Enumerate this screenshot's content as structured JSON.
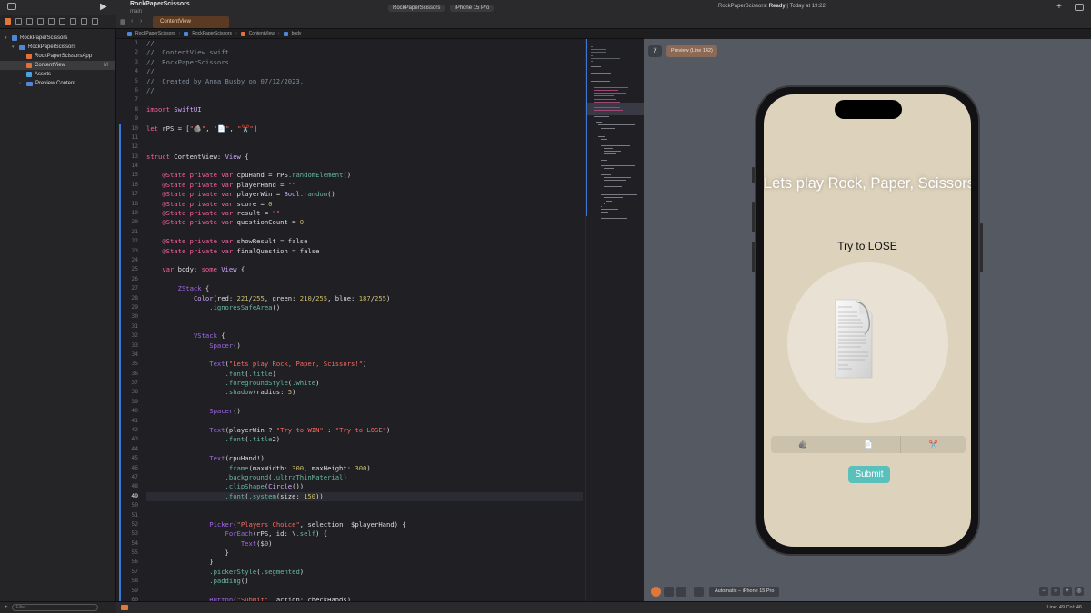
{
  "titlebar": {
    "project": "RockPaperScissors",
    "branch": "main",
    "scheme_target": "RockPaperScissors",
    "scheme_device": "iPhone 15 Pro",
    "status_prefix": "RockPaperScissors: ",
    "status_state": "Ready",
    "status_time": " | Today at 19:22"
  },
  "navigator": {
    "items": [
      {
        "label": "RockPaperScissors",
        "indent": 0,
        "icon": "project-icon",
        "chevron": "▾"
      },
      {
        "label": "RockPaperScissors",
        "indent": 1,
        "icon": "folder-icon",
        "chevron": "▾"
      },
      {
        "label": "RockPaperScissorsApp",
        "indent": 2,
        "icon": "swift-file-icon",
        "chevron": ""
      },
      {
        "label": "ContentView",
        "indent": 2,
        "icon": "swift-file-icon",
        "chevron": "",
        "badge": "M",
        "selected": true
      },
      {
        "label": "Assets",
        "indent": 2,
        "icon": "asset-catalog-icon",
        "chevron": ""
      },
      {
        "label": "Preview Content",
        "indent": 2,
        "icon": "folder-icon",
        "chevron": "›"
      }
    ],
    "filter_placeholder": "Filter"
  },
  "tab": {
    "label": "ContentView"
  },
  "jumpbar": [
    "RockPaperScissors",
    "RockPaperScissors",
    "ContentView",
    "body"
  ],
  "editor": {
    "current_line": 49,
    "lines": [
      "//",
      "//  ContentView.swift",
      "//  RockPaperScissors",
      "//",
      "//  Created by Anna Busby on 07/12/2023.",
      "//",
      "",
      "import SwiftUI",
      "",
      "let rPS = [\"🪨\", \"📄\", \"✂️\"]",
      "",
      "",
      "struct ContentView: View {",
      "",
      "    @State private var cpuHand = rPS.randomElement()",
      "    @State private var playerHand = \"\"",
      "    @State private var playerWin = Bool.random()",
      "    @State private var score = 0",
      "    @State private var result = \"\"",
      "    @State private var questionCount = 0",
      "",
      "    @State private var showResult = false",
      "    @State private var finalQuestion = false",
      "",
      "    var body: some View {",
      "",
      "        ZStack {",
      "            Color(red: 221/255, green: 210/255, blue: 187/255)",
      "                .ignoresSafeArea()",
      "",
      "",
      "            VStack {",
      "                Spacer()",
      "",
      "                Text(\"Lets play Rock, Paper, Scissors!\")",
      "                    .font(.title)",
      "                    .foregroundStyle(.white)",
      "                    .shadow(radius: 5)",
      "",
      "                Spacer()",
      "",
      "                Text(playerWin ? \"Try to WIN\" : \"Try to LOSE\")",
      "                    .font(.title2)",
      "",
      "                Text(cpuHand!)",
      "                    .frame(maxWidth: 300, maxHeight: 300)",
      "                    .background(.ultraThinMaterial)",
      "                    .clipShape(Circle())",
      "                    .font(.system(size: 150))",
      "",
      "",
      "                Picker(\"Players Choice\", selection: $playerHand) {",
      "                    ForEach(rPS, id: \\.self) {",
      "                        Text($0)",
      "                    }",
      "                }",
      "                .pickerStyle(.segmented)",
      "                .padding()",
      "",
      "                Button(\"Submit\", action: checkHands)"
    ]
  },
  "canvas": {
    "preview_label": "Preview (Line 142)",
    "device_label": "Automatic – iPhone 15 Pro"
  },
  "app_screen": {
    "background": "#ddd2bb",
    "title": "Lets play Rock, Paper, Scissors!",
    "instruction": "Try to LOSE",
    "cpu_hand": "📄",
    "picker_options": [
      "🪨",
      "📄",
      "✂️"
    ],
    "submit_label": "Submit",
    "submit_color": "#59c0bc"
  },
  "statusbar": {
    "position": "Line: 49  Col: 46"
  }
}
